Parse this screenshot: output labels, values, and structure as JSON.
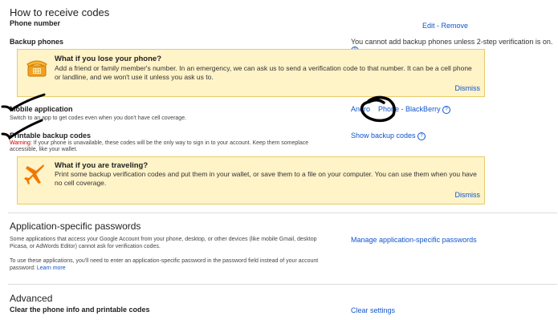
{
  "receive": {
    "heading": "How to receive codes",
    "phone_number_label": "Phone number",
    "edit_remove_link": "Edit - Remove"
  },
  "backup_phones": {
    "label": "Backup phones",
    "notice": "You cannot add backup phones unless 2-step verification is on.",
    "help": "?"
  },
  "tip_phone": {
    "title": "What if you lose your phone?",
    "body": "Add a friend or family member's number. In an emergency, we can ask us to send a verification code to that number. It can be a cell phone or landline, and we won't use it unless you ask us to.",
    "dismiss": "Dismiss"
  },
  "mobile_app": {
    "label": "Mobile application",
    "desc": "Switch to an app to get codes even when you don't have cell coverage.",
    "link_prefix": "Andro",
    "link_rest": "Phone - BlackBerry",
    "help": "?"
  },
  "printable": {
    "label": "Printable backup codes",
    "warning_label": "Warning:",
    "warning_text": " If your phone is unavailable, these codes will be the only way to sign in to your account. Keep them someplace accessible, like your wallet.",
    "link": "Show backup codes",
    "help": "?"
  },
  "tip_travel": {
    "title": "What if you are traveling?",
    "body": "Print some backup verification codes and put them in your wallet, or save them to a file on your computer. You can use them when you have no cell coverage.",
    "dismiss": "Dismiss"
  },
  "app_passwords": {
    "heading": "Application-specific passwords",
    "desc1": "Some applications that access your Google Account from your phone, desktop, or other devices (like mobile Gmail, desktop Picasa, or AdWords Editor) cannot ask for verification codes.",
    "desc2": "To use these applications, you'll need to enter an application-specific password in the password field instead of your account password:",
    "learn_more": "Learn more",
    "link": "Manage application-specific passwords"
  },
  "advanced": {
    "heading": "Advanced",
    "label": "Clear the phone info and printable codes",
    "link": "Clear settings"
  },
  "colors": {
    "link": "#1155cc",
    "tip_bg": "#fff3c8",
    "tip_border": "#e8cc6a",
    "warning": "#cc0000"
  }
}
